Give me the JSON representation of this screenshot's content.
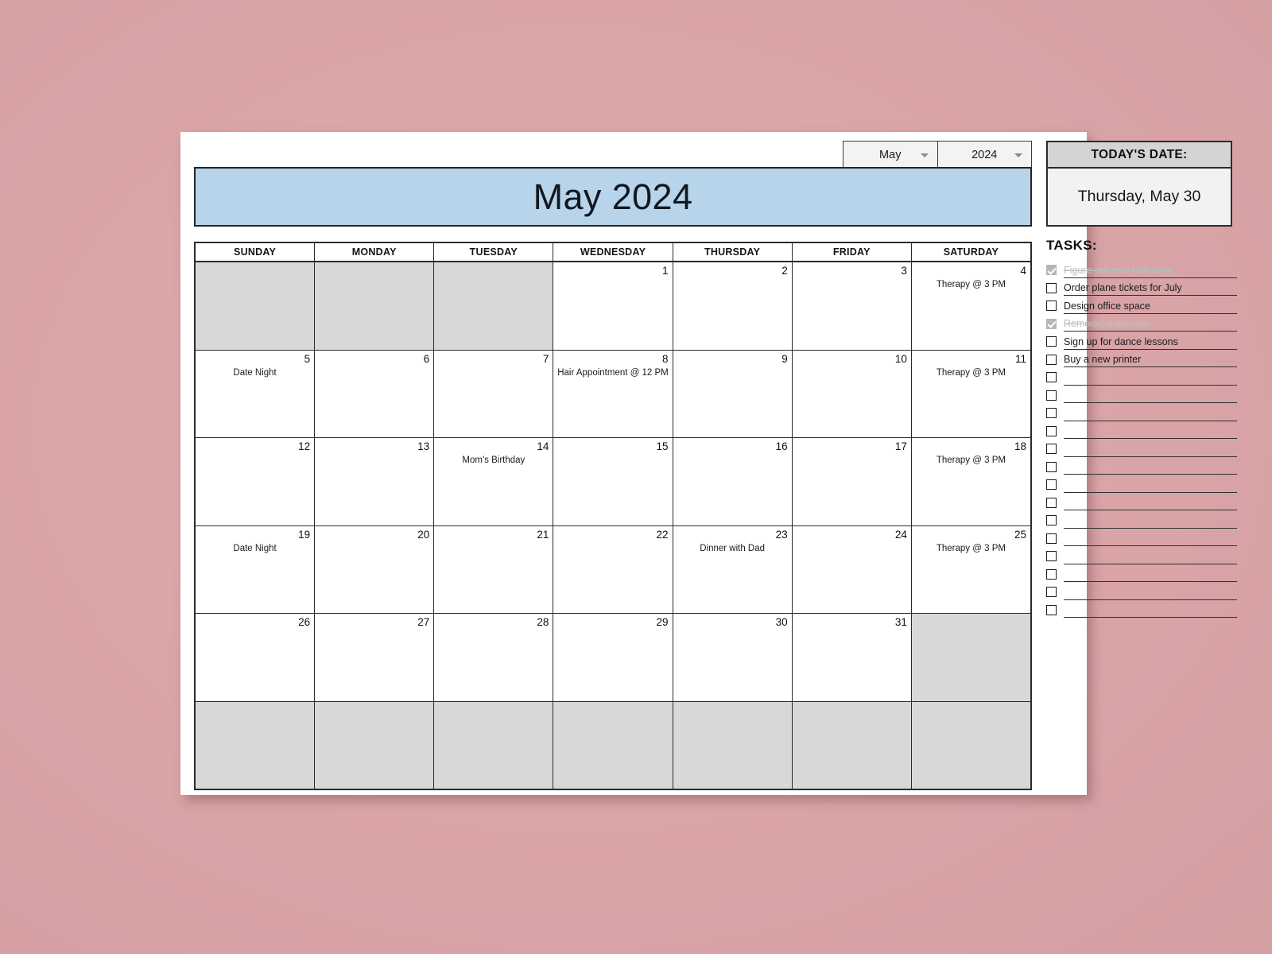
{
  "background_color": "#dba6a8",
  "banner_color": "#b8d4ea",
  "controls": {
    "month_select": {
      "value": "May",
      "caret_icon": "chevron-down-icon"
    },
    "year_select": {
      "value": "2024",
      "caret_icon": "chevron-down-icon"
    }
  },
  "banner": {
    "title": "May 2024"
  },
  "today": {
    "label": "TODAY'S DATE:",
    "value": "Thursday, May 30"
  },
  "calendar": {
    "day_headers": [
      "SUNDAY",
      "MONDAY",
      "TUESDAY",
      "WEDNESDAY",
      "THURSDAY",
      "FRIDAY",
      "SATURDAY"
    ],
    "weeks": [
      [
        {
          "day": "",
          "event": "",
          "pad": true
        },
        {
          "day": "",
          "event": "",
          "pad": true
        },
        {
          "day": "",
          "event": "",
          "pad": true
        },
        {
          "day": "1",
          "event": ""
        },
        {
          "day": "2",
          "event": ""
        },
        {
          "day": "3",
          "event": ""
        },
        {
          "day": "4",
          "event": "Therapy @ 3 PM"
        }
      ],
      [
        {
          "day": "5",
          "event": "Date Night"
        },
        {
          "day": "6",
          "event": ""
        },
        {
          "day": "7",
          "event": ""
        },
        {
          "day": "8",
          "event": "Hair Appointment @ 12 PM"
        },
        {
          "day": "9",
          "event": ""
        },
        {
          "day": "10",
          "event": ""
        },
        {
          "day": "11",
          "event": "Therapy @ 3 PM"
        }
      ],
      [
        {
          "day": "12",
          "event": ""
        },
        {
          "day": "13",
          "event": ""
        },
        {
          "day": "14",
          "event": "Mom's Birthday"
        },
        {
          "day": "15",
          "event": ""
        },
        {
          "day": "16",
          "event": ""
        },
        {
          "day": "17",
          "event": ""
        },
        {
          "day": "18",
          "event": "Therapy @ 3 PM"
        }
      ],
      [
        {
          "day": "19",
          "event": "Date Night"
        },
        {
          "day": "20",
          "event": ""
        },
        {
          "day": "21",
          "event": ""
        },
        {
          "day": "22",
          "event": ""
        },
        {
          "day": "23",
          "event": "Dinner with Dad"
        },
        {
          "day": "24",
          "event": ""
        },
        {
          "day": "25",
          "event": "Therapy @ 3 PM"
        }
      ],
      [
        {
          "day": "26",
          "event": ""
        },
        {
          "day": "27",
          "event": ""
        },
        {
          "day": "28",
          "event": ""
        },
        {
          "day": "29",
          "event": ""
        },
        {
          "day": "30",
          "event": ""
        },
        {
          "day": "31",
          "event": ""
        },
        {
          "day": "",
          "event": "",
          "pad": true
        }
      ],
      [
        {
          "day": "",
          "event": "",
          "pad": true
        },
        {
          "day": "",
          "event": "",
          "pad": true
        },
        {
          "day": "",
          "event": "",
          "pad": true
        },
        {
          "day": "",
          "event": "",
          "pad": true
        },
        {
          "day": "",
          "event": "",
          "pad": true
        },
        {
          "day": "",
          "event": "",
          "pad": true
        },
        {
          "day": "",
          "event": "",
          "pad": true
        }
      ]
    ]
  },
  "tasks": {
    "title": "TASKS:",
    "items": [
      {
        "text": "Figure out new hair style",
        "checked": true
      },
      {
        "text": "Order plane tickets for July",
        "checked": false
      },
      {
        "text": "Design office space",
        "checked": false
      },
      {
        "text": "Remodel Bathroom",
        "checked": true
      },
      {
        "text": "Sign up for dance lessons",
        "checked": false
      },
      {
        "text": "Buy a new printer",
        "checked": false
      },
      {
        "text": "",
        "checked": false
      },
      {
        "text": "",
        "checked": false
      },
      {
        "text": "",
        "checked": false
      },
      {
        "text": "",
        "checked": false
      },
      {
        "text": "",
        "checked": false
      },
      {
        "text": "",
        "checked": false
      },
      {
        "text": "",
        "checked": false
      },
      {
        "text": "",
        "checked": false
      },
      {
        "text": "",
        "checked": false
      },
      {
        "text": "",
        "checked": false
      },
      {
        "text": "",
        "checked": false
      },
      {
        "text": "",
        "checked": false
      },
      {
        "text": "",
        "checked": false
      },
      {
        "text": "",
        "checked": false
      }
    ]
  }
}
